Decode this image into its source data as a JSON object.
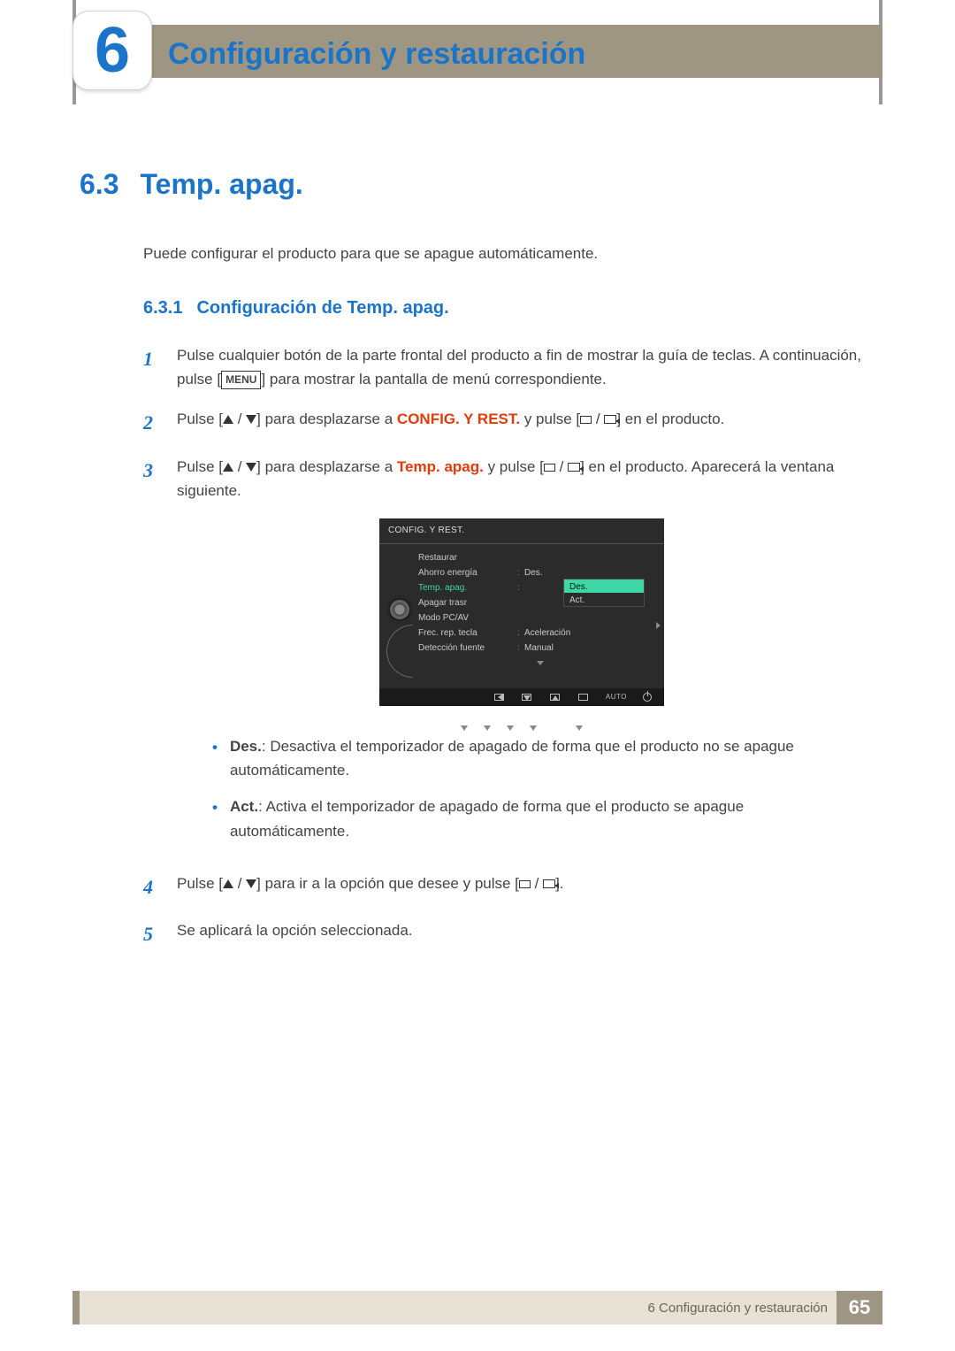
{
  "chapter": {
    "number": "6",
    "title": "Configuración y restauración"
  },
  "section": {
    "number": "6.3",
    "title": "Temp. apag."
  },
  "intro": "Puede configurar el producto para que se apague automáticamente.",
  "subsection": {
    "number": "6.3.1",
    "title": "Configuración de Temp. apag."
  },
  "steps": {
    "s1": {
      "num": "1",
      "t1": "Pulse cualquier botón de la parte frontal del producto a fin de mostrar la guía de teclas. A continuación, pulse [",
      "menu": "MENU",
      "t2": "] para mostrar la pantalla de menú correspondiente."
    },
    "s2": {
      "num": "2",
      "t1": "Pulse [",
      "t2": "] para desplazarse a ",
      "hl": "CONFIG. Y REST.",
      "t3": " y pulse [",
      "t4": "] en el producto."
    },
    "s3": {
      "num": "3",
      "t1": "Pulse [",
      "t2": "] para desplazarse a ",
      "hl": "Temp. apag.",
      "t3": " y pulse [",
      "t4": "] en el producto. Aparecerá la ventana siguiente."
    },
    "s4": {
      "num": "4",
      "t1": "Pulse [",
      "t2": "] para ir a la opción que desee y pulse [",
      "t3": "]."
    },
    "s5": {
      "num": "5",
      "text": "Se aplicará la opción seleccionada."
    }
  },
  "bullets": {
    "des": {
      "label": "Des.",
      "text": ": Desactiva el temporizador de apagado de forma que el producto no se apague automáticamente."
    },
    "act": {
      "label": "Act.",
      "text": ": Activa el temporizador de apagado de forma que el producto se apague automáticamente."
    }
  },
  "osd": {
    "title": "CONFIG. Y REST.",
    "rows": {
      "r0": {
        "label": "Restaurar",
        "val": ""
      },
      "r1": {
        "label": "Ahorro energía",
        "val": "Des."
      },
      "r2": {
        "label": "Temp. apag.",
        "val": ""
      },
      "r3": {
        "label": "Apagar trasr",
        "val": ""
      },
      "r4": {
        "label": "Modo PC/AV",
        "val": ""
      },
      "r5": {
        "label": "Frec. rep. tecla",
        "val": "Aceleración"
      },
      "r6": {
        "label": "Detección fuente",
        "val": "Manual"
      }
    },
    "options": {
      "o0": "Des.",
      "o1": "Act."
    },
    "auto": "AUTO"
  },
  "footer": {
    "text": "6 Configuración y restauración",
    "page": "65"
  }
}
